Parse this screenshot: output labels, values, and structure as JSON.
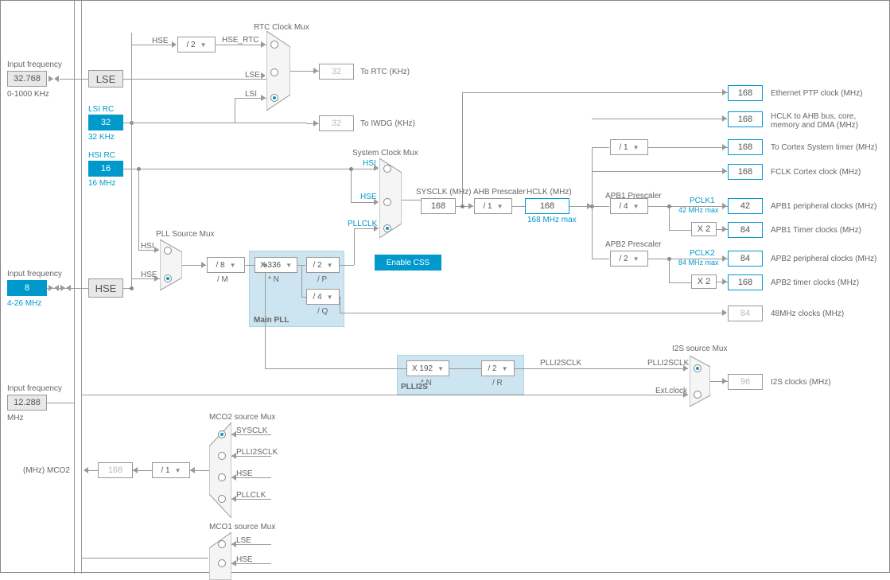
{
  "inputs": {
    "lse_label": "Input frequency",
    "lse_val": "32.768",
    "lse_range": "0-1000 KHz",
    "hse_label": "Input frequency",
    "hse_val": "8",
    "hse_range": "4-26 MHz",
    "i2s_label": "Input frequency",
    "i2s_val": "12.288",
    "i2s_unit": "MHz",
    "mco2_label": "(MHz) MCO2"
  },
  "osc": {
    "lse": "LSE",
    "lsi_rc": "LSI RC",
    "lsi_val": "32",
    "lsi_unit": "32 KHz",
    "hsi_rc": "HSI RC",
    "hsi_val": "16",
    "hsi_unit": "16 MHz",
    "hse": "HSE"
  },
  "rtc": {
    "title": "RTC Clock Mux",
    "hse_div_sel": "/ 2",
    "hse_rtc": "HSE_RTC",
    "hse": "HSE",
    "lse": "LSE",
    "lsi": "LSI",
    "to_rtc_val": "32",
    "to_rtc_lbl": "To RTC (KHz)",
    "to_iwdg_val": "32",
    "to_iwdg_lbl": "To IWDG (KHz)"
  },
  "pllsrc": {
    "title": "PLL Source Mux",
    "hsi": "HSI",
    "hse": "HSE",
    "divm_sel": "/ 8",
    "divm_lbl": "/ M"
  },
  "pll": {
    "title": "Main PLL",
    "n_sel": "X 336",
    "n_lbl": "* N",
    "p_sel": "/ 2",
    "p_lbl": "/ P",
    "q_sel": "/ 4",
    "q_lbl": "/ Q"
  },
  "plli2s": {
    "title": "PLLI2S",
    "n_sel": "X 192",
    "n_lbl": "* N",
    "r_sel": "/ 2",
    "r_lbl": "/ R",
    "clk": "PLLI2SCLK"
  },
  "sysclk": {
    "title": "System Clock Mux",
    "hsi": "HSI",
    "hse": "HSE",
    "pllclk": "PLLCLK",
    "css": "Enable CSS",
    "sysclk_lbl": "SYSCLK (MHz)",
    "sysclk_val": "168",
    "ahb_lbl": "AHB Prescaler",
    "ahb_sel": "/ 1",
    "hclk_lbl": "HCLK (MHz)",
    "hclk_val": "168",
    "hclk_max": "168 MHz max"
  },
  "apb1": {
    "lbl": "APB1 Prescaler",
    "sel": "/ 4",
    "pclk": "PCLK1",
    "max": "42 MHz max",
    "mult": "X 2"
  },
  "apb2": {
    "lbl": "APB2 Prescaler",
    "sel": "/ 2",
    "pclk": "PCLK2",
    "max": "84 MHz max",
    "mult": "X 2"
  },
  "cortex": {
    "sel": "/ 1"
  },
  "outputs": {
    "eth": {
      "val": "168",
      "lbl": "Ethernet PTP clock (MHz)"
    },
    "hclk": {
      "val": "168",
      "lbl": "HCLK to AHB bus, core, memory and DMA (MHz)"
    },
    "cortex_sys": {
      "val": "168",
      "lbl": "To Cortex System timer (MHz)"
    },
    "fclk": {
      "val": "168",
      "lbl": "FCLK Cortex clock (MHz)"
    },
    "apb1_p": {
      "val": "42",
      "lbl": "APB1 peripheral clocks (MHz)"
    },
    "apb1_t": {
      "val": "84",
      "lbl": "APB1 Timer clocks (MHz)"
    },
    "apb2_p": {
      "val": "84",
      "lbl": "APB2 peripheral clocks (MHz)"
    },
    "apb2_t": {
      "val": "168",
      "lbl": "APB2 timer clocks (MHz)"
    },
    "usb48": {
      "val": "84",
      "lbl": "48MHz clocks (MHz)"
    },
    "i2s": {
      "val": "96",
      "lbl": "I2S clocks (MHz)"
    }
  },
  "i2s_mux": {
    "title": "I2S source Mux",
    "src1": "PLLI2SCLK",
    "src2": "Ext.clock"
  },
  "mco2": {
    "title": "MCO2 source Mux",
    "val": "168",
    "sel": "/ 1",
    "o1": "SYSCLK",
    "o2": "PLLI2SCLK",
    "o3": "HSE",
    "o4": "PLLCLK"
  },
  "mco1": {
    "title": "MCO1 source Mux",
    "o1": "LSE",
    "o2": "HSE"
  }
}
